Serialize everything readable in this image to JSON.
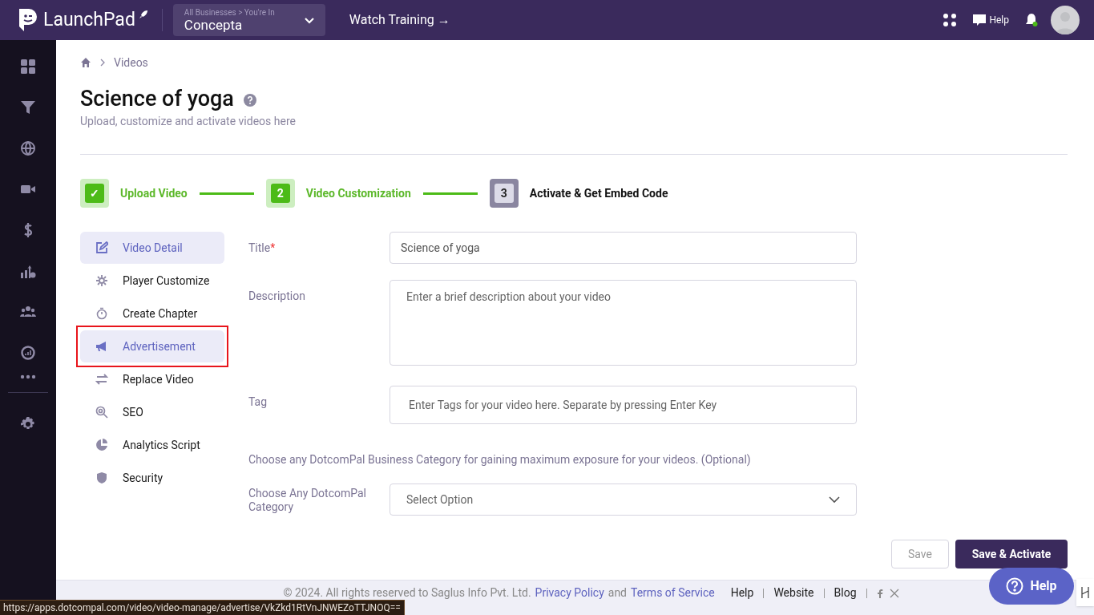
{
  "topbar": {
    "logo": "LaunchPad",
    "business_crumb": "All Businesses > You're In",
    "business": "Concepta",
    "watch_training": "Watch Training →",
    "help": "Help"
  },
  "breadcrumb": [
    "Videos"
  ],
  "page": {
    "title": "Science of yoga",
    "subtitle": "Upload, customize and activate videos here"
  },
  "steps": [
    {
      "marker": "✓",
      "label": "Upload Video",
      "done": true
    },
    {
      "marker": "2",
      "label": "Video Customization",
      "done": true
    },
    {
      "marker": "3",
      "label": "Activate & Get Embed Code",
      "done": false
    }
  ],
  "menu": [
    {
      "label": "Video Detail",
      "selected": true,
      "outlined": false
    },
    {
      "label": "Player Customize",
      "selected": false,
      "outlined": false
    },
    {
      "label": "Create Chapter",
      "selected": false,
      "outlined": false
    },
    {
      "label": "Advertisement",
      "selected": true,
      "outlined": true
    },
    {
      "label": "Replace Video",
      "selected": false,
      "outlined": false
    },
    {
      "label": "SEO",
      "selected": false,
      "outlined": false
    },
    {
      "label": "Analytics Script",
      "selected": false,
      "outlined": false
    },
    {
      "label": "Security",
      "selected": false,
      "outlined": false
    }
  ],
  "form": {
    "title_label": "Title",
    "required_mark": "*",
    "title_value": "Science of yoga",
    "description_label": "Description",
    "description_placeholder": "Enter a brief description about your video",
    "tag_label": "Tag",
    "tag_placeholder": "Enter Tags for your video here. Separate by pressing Enter Key",
    "category_note": "Choose any DotcomPal Business Category for gaining maximum exposure for your videos. (Optional)",
    "category_label": "Choose Any DotcomPal Category",
    "category_placeholder": "Select Option"
  },
  "buttons": {
    "save": "Save",
    "save_activate": "Save & Activate"
  },
  "footer": {
    "copyright": "©  2024. All rights reserved to Saglus Info Pvt. Ltd.",
    "privacy": "Privacy Policy",
    "and": "and",
    "terms": "Terms of Service",
    "links": [
      "Help",
      "Website",
      "Blog"
    ]
  },
  "help_bubble": "Help",
  "status_url": "https://apps.dotcompal.com/video/video-manage/advertise/VkZkd1RtVnJNWEZoTTJNOQ=="
}
